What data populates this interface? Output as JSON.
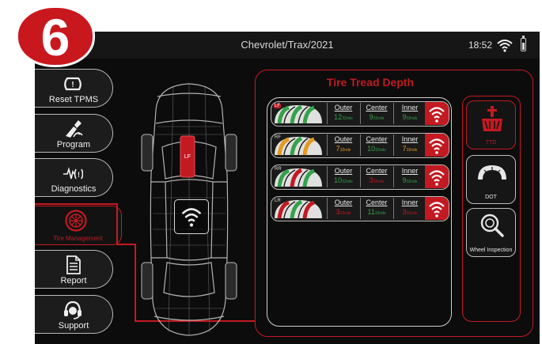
{
  "badge": {
    "number": "6"
  },
  "status_bar": {
    "title": "Chevrolet/Trax/2021",
    "time": "18:52"
  },
  "sidebar": {
    "items": [
      {
        "label": "Reset TPMS",
        "icon": "reset-tpms-icon"
      },
      {
        "label": "Program",
        "icon": "program-icon"
      },
      {
        "label": "Diagnostics",
        "icon": "diagnostics-icon"
      },
      {
        "label": "Tire Management",
        "icon": "tire-management-icon",
        "active": true
      },
      {
        "label": "Report",
        "icon": "report-icon"
      },
      {
        "label": "Support",
        "icon": "support-icon"
      }
    ]
  },
  "vehicle": {
    "highlighted_wheel": "LF"
  },
  "tread_panel": {
    "title": "Tire Tread Depth",
    "headers": {
      "outer": "Outer",
      "center": "Center",
      "inner": "Inner"
    },
    "unit": "32nds",
    "tires": [
      {
        "position": "LF",
        "outer": "12",
        "center": "9",
        "inner": "9",
        "status": [
          "green",
          "green",
          "green"
        ]
      },
      {
        "position": "RF",
        "outer": "7",
        "center": "10",
        "inner": "7",
        "status": [
          "orange",
          "green",
          "orange"
        ]
      },
      {
        "position": "RR",
        "outer": "10",
        "center": "3",
        "inner": "9",
        "status": [
          "green",
          "red",
          "green"
        ]
      },
      {
        "position": "LR",
        "outer": "3",
        "center": "11",
        "inner": "3",
        "status": [
          "red",
          "green",
          "red"
        ]
      }
    ]
  },
  "tools": [
    {
      "label": "TTD",
      "icon": "tread-depth-icon",
      "active": true
    },
    {
      "label": "DOT",
      "icon": "dot-icon"
    },
    {
      "label": "Wheel Inspection",
      "icon": "wheel-inspection-icon"
    }
  ],
  "colors": {
    "accent": "#c31a22",
    "good": "#34a24a",
    "warn": "#e39a1e",
    "bad": "#c31a22"
  }
}
